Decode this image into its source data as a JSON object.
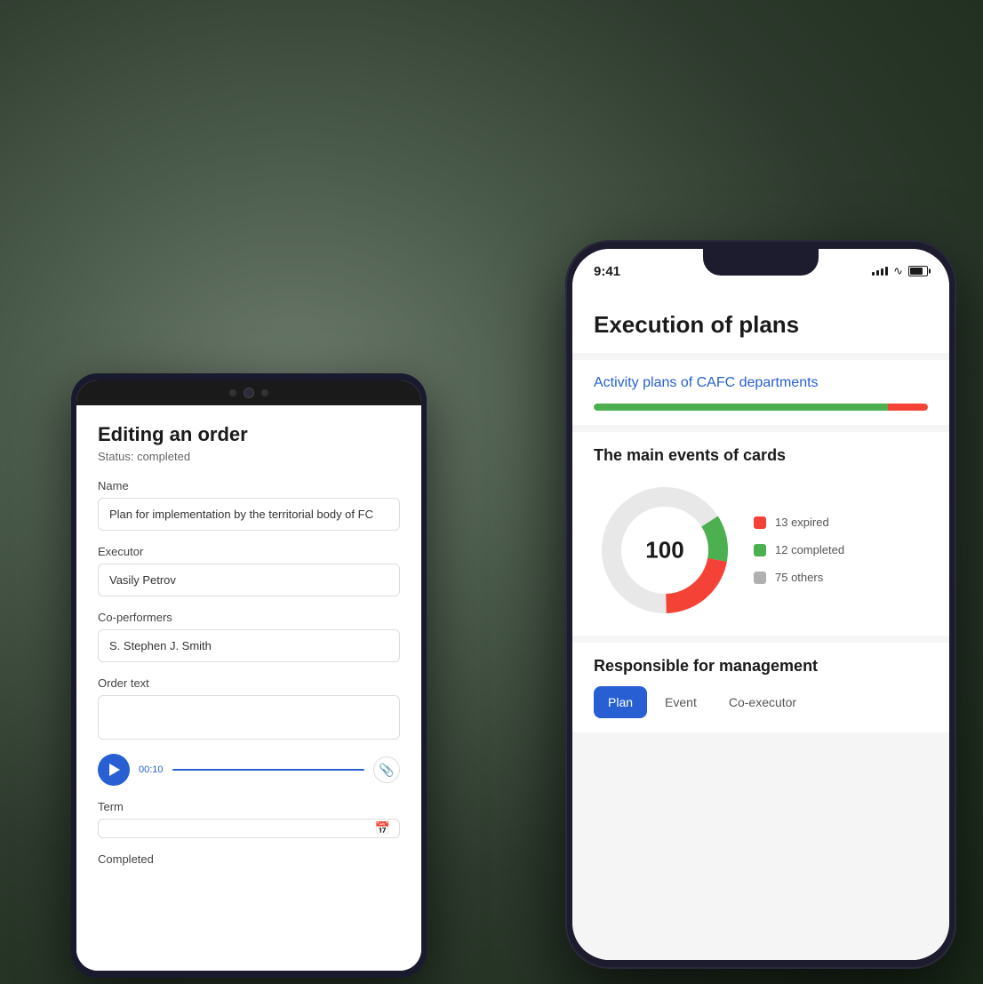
{
  "android": {
    "title": "Editing an order",
    "status": "Status: completed",
    "fields": {
      "name_label": "Name",
      "name_value": "Plan for implementation by the territorial body of FC",
      "executor_label": "Executor",
      "executor_value": "Vasily Petrov",
      "co_performers_label": "Co-performers",
      "co_performers_value": "S. Stephen  J. Smith",
      "order_text_label": "Order text",
      "order_text_value": "",
      "term_label": "Term",
      "term_value": "",
      "completed_label": "Completed"
    },
    "audio": {
      "time": "00:10"
    }
  },
  "ios": {
    "status_bar": {
      "time": "9:41"
    },
    "title": "Execution of plans",
    "card": {
      "link_text": "Activity plans of CAFC departments",
      "progress_percent": 88
    },
    "events": {
      "title": "The main events of cards",
      "total": "100",
      "legend": [
        {
          "color": "#f44336",
          "label": "13 expired"
        },
        {
          "color": "#4caf50",
          "label": "12 completed"
        },
        {
          "color": "#b0b0b0",
          "label": "75 others"
        }
      ]
    },
    "responsible": {
      "title": "Responsible for management",
      "tabs": [
        {
          "label": "Plan",
          "active": true
        },
        {
          "label": "Event",
          "active": false
        },
        {
          "label": "Co-executor",
          "active": false
        }
      ]
    }
  }
}
